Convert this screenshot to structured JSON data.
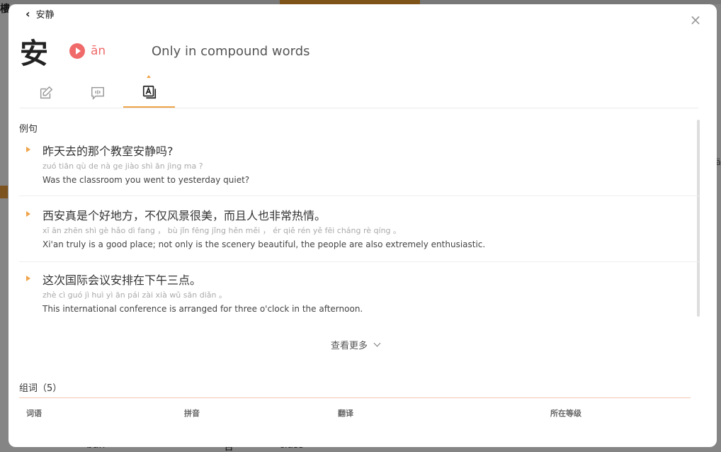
{
  "background": {
    "edge_char": "樓",
    "right_tag": "ä",
    "bottom_texts": [
      "ban",
      "合",
      "class"
    ]
  },
  "header": {
    "back_label": "安静",
    "character": "安",
    "pinyin": "ān",
    "meaning": "Only in compound words"
  },
  "tabs": [
    {
      "icon": "edit-icon",
      "active": false
    },
    {
      "icon": "speech-icon",
      "active": false
    },
    {
      "icon": "translate-icon",
      "active": true
    }
  ],
  "examples": {
    "title": "例句",
    "items": [
      {
        "cn": "昨天去的那个教室安静吗?",
        "py": "zuó tiān qù de nà ge jiào shì ān jìng ma ?",
        "en": "Was the classroom you went to yesterday quiet?"
      },
      {
        "cn": "西安真是个好地方，不仅风景很美，而且人也非常热情。",
        "py": "xī ān zhēn shì gè hǎo dì fang ， bù jǐn fēng jǐng hěn měi ， ér qiě rén yě fēi cháng rè qíng 。",
        "en": "Xi'an truly is a good place; not only is the scenery beautiful, the people are also extremely enthusiastic."
      },
      {
        "cn": "这次国际会议安排在下午三点。",
        "py": "zhè cì guó jì huì yì ān pái zài xià wǔ sān diǎn 。",
        "en": "This international conference is arranged for three o'clock in the afternoon."
      }
    ],
    "more_label": "查看更多"
  },
  "words": {
    "title": "组词（5）",
    "columns": [
      "词语",
      "拼音",
      "翻译",
      "所在等级"
    ]
  },
  "colors": {
    "accent_orange": "#f0a44a",
    "pinyin_red": "#f06a6a"
  }
}
